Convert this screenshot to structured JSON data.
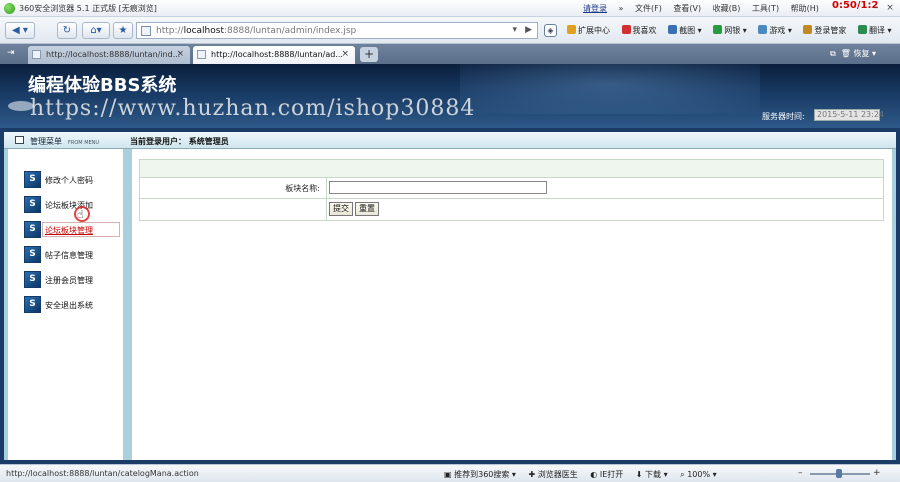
{
  "browser": {
    "window_title": "360安全浏览器 5.1 正式版 [无痕浏览]",
    "menu": [
      "请登录",
      "»",
      "文件(F)",
      "查看(V)",
      "收藏(B)",
      "工具(T)",
      "帮助(H)"
    ],
    "clock": "0:50/1:2",
    "address_prefix": "http://",
    "address_host": "localhost",
    "address_rest": ":8888/luntan/admin/index.jsp",
    "toolbar": [
      "扩展中心",
      "我喜欢",
      "截图",
      "网银",
      "游戏",
      "登录管家",
      "翻译"
    ],
    "tabs": [
      {
        "label": "http://localhost:8888/luntan/ind...",
        "active": false
      },
      {
        "label": "http://localhost:8888/luntan/ad...",
        "active": true
      }
    ],
    "tabbar_right": "恢复",
    "status_url": "http://localhost:8888/luntan/catelogMana.action",
    "status_items": [
      "推荐到360搜索",
      "浏览器医生",
      "IE打开",
      "下载",
      "100%"
    ]
  },
  "site": {
    "title": "编程体验BBS系统",
    "watermark": "https://www.huzhan.com/ishop30884",
    "server_time_label": "服务器时间:",
    "server_time": "2015-5-11 23:24"
  },
  "sidebar": {
    "title": "管理菜单",
    "subtitle": "FROM MENU",
    "items": [
      {
        "label": "修改个人密码",
        "active": false
      },
      {
        "label": "论坛板块添加",
        "active": false
      },
      {
        "label": "论坛板块管理",
        "active": true
      },
      {
        "label": "帖子信息管理",
        "active": false
      },
      {
        "label": "注册会员管理",
        "active": false
      },
      {
        "label": "安全退出系统",
        "active": false
      }
    ]
  },
  "main": {
    "current_user": "当前登录用户：  系统管理员",
    "form": {
      "field_label": "板块名称:",
      "field_value": "",
      "submit": "提交",
      "reset": "重置"
    }
  }
}
